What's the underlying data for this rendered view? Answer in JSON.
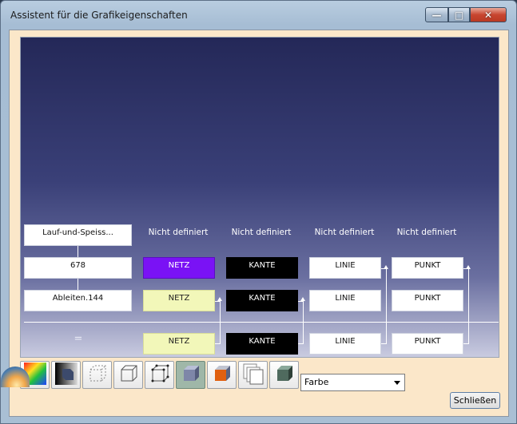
{
  "window": {
    "title": "Assistent für die Grafikeigenschaften",
    "minimize_glyph": "—",
    "maximize_glyph": "□",
    "close_glyph": "✕"
  },
  "viewport": {
    "background_top": "#242858",
    "background_bottom": "#c9cbe0",
    "row0": {
      "left_node": "Lauf-und-Speiss...",
      "labels": [
        "Nicht definiert",
        "Nicht definiert",
        "Nicht definiert",
        "Nicht definiert"
      ]
    },
    "row1": {
      "left_node": "678",
      "cells": [
        "NETZ",
        "KANTE",
        "LINIE",
        "PUNKT"
      ]
    },
    "row2": {
      "left_node": "Ableiten.144",
      "cells": [
        "NETZ",
        "KANTE",
        "LINIE",
        "PUNKT"
      ]
    },
    "row3": {
      "equals_symbol": "=",
      "cells": [
        "NETZ",
        "KANTE",
        "LINIE",
        "PUNKT"
      ]
    },
    "colors": {
      "netz_row1": "#7a12f5",
      "netz_yellow": "#f2f7b9",
      "kante": "#000000"
    }
  },
  "toolbar": {
    "icons": [
      "color-palette-icon",
      "gradient-cube-icon",
      "dotted-cube-icon",
      "wireframe-cube-icon",
      "vertex-cube-icon",
      "shaded-cube-icon",
      "orange-face-cube-icon",
      "layers-icon",
      "solid-cube-icon"
    ],
    "active_index": 5,
    "dropdown_value": "Farbe"
  },
  "close_button_label": "Schließen"
}
